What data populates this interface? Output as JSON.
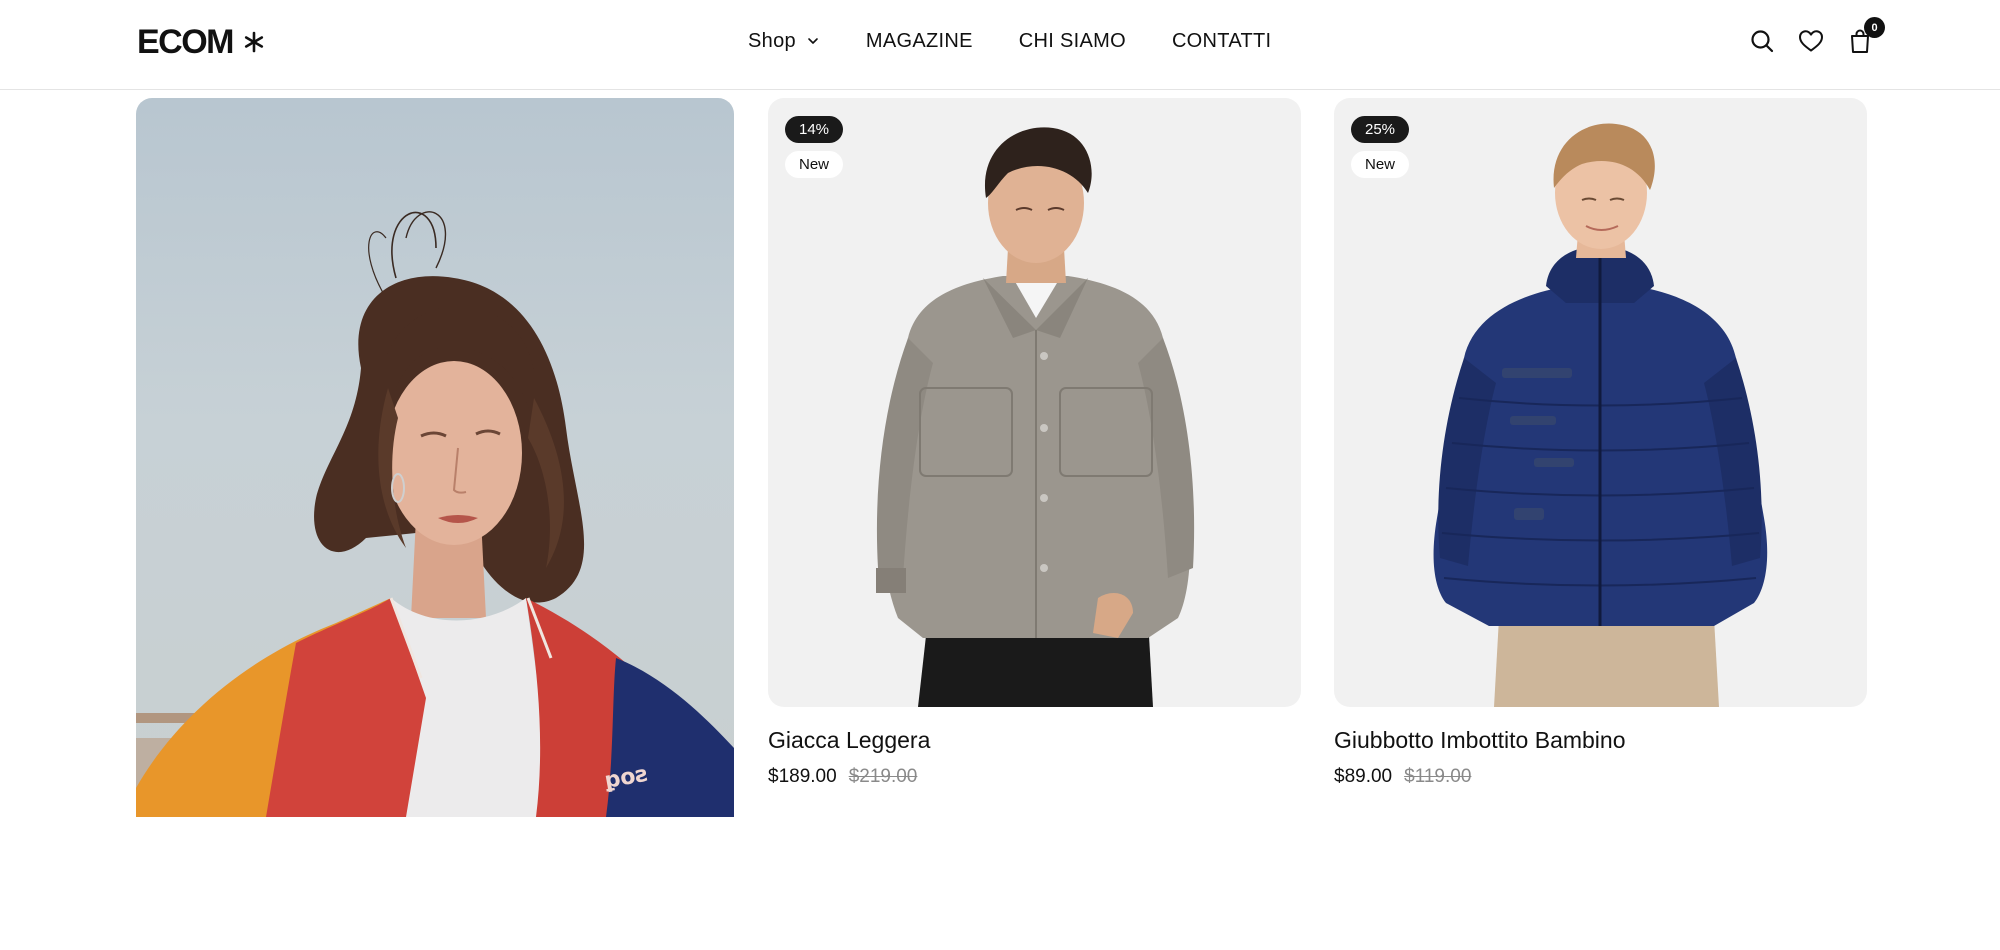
{
  "header": {
    "logo": "ECOM",
    "logo_icon": "asterisk-icon",
    "nav": [
      {
        "label": "Shop",
        "icon": "chevron-down-icon"
      },
      {
        "label": "MAGAZINE"
      },
      {
        "label": "CHI SIAMO"
      },
      {
        "label": "CONTATTI"
      }
    ],
    "icons": [
      "search-icon",
      "heart-icon",
      "bag-icon"
    ],
    "cart_count": "0"
  },
  "hero": {
    "image": "woman-in-colorblock-jacket-photo"
  },
  "products": [
    {
      "discount": "14%",
      "tag": "New",
      "name": "Giacca Leggera",
      "price": "$189.00",
      "old_price": "$219.00",
      "image": "man-in-grey-overshirt-photo"
    },
    {
      "discount": "25%",
      "tag": "New",
      "name": "Giubbotto Imbottito Bambino",
      "price": "$89.00",
      "old_price": "$119.00",
      "image": "boy-in-navy-puffer-jacket-photo"
    }
  ],
  "colors": {
    "text": "#111111",
    "muted": "#8a8a8a",
    "card_bg": "#f1f1f1",
    "badge_dark": "#1a1a1a"
  }
}
